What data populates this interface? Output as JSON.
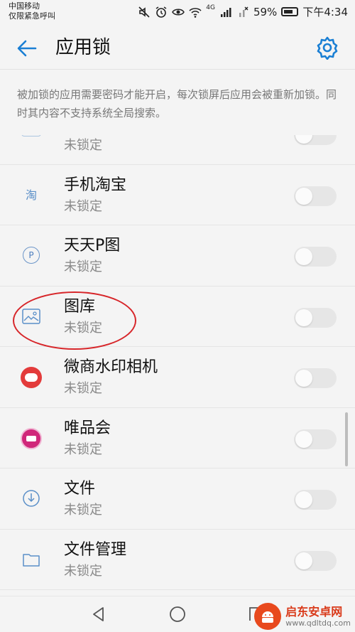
{
  "status_bar": {
    "carrier_line1": "中国移动",
    "carrier_line2": "仅限紧急呼叫",
    "network_label": "4G",
    "battery": "59%",
    "time": "下午4:34"
  },
  "header": {
    "title": "应用锁"
  },
  "description": "被加锁的应用需要密码才能开启，每次锁屏后应用会被重新加锁。同时其内容不支持系统全局搜索。",
  "apps": [
    {
      "name": "",
      "status": "未锁定",
      "icon": "app-icon-partial",
      "locked": false
    },
    {
      "name": "手机淘宝",
      "status": "未锁定",
      "icon": "taobao-icon",
      "locked": false
    },
    {
      "name": "天天P图",
      "status": "未锁定",
      "icon": "ptu-icon",
      "locked": false
    },
    {
      "name": "图库",
      "status": "未锁定",
      "icon": "gallery-icon",
      "locked": false
    },
    {
      "name": "微商水印相机",
      "status": "未锁定",
      "icon": "watermark-camera-icon",
      "locked": false
    },
    {
      "name": "唯品会",
      "status": "未锁定",
      "icon": "vipshop-icon",
      "locked": false
    },
    {
      "name": "文件",
      "status": "未锁定",
      "icon": "files-icon",
      "locked": false
    },
    {
      "name": "文件管理",
      "status": "未锁定",
      "icon": "file-manager-icon",
      "locked": false
    }
  ],
  "watermark": {
    "name": "启东安卓网",
    "url": "www.qdltdq.com"
  },
  "colors": {
    "accent": "#1a7fd4",
    "highlight": "#d7262a",
    "toggle_off": "#e6e6e6"
  }
}
